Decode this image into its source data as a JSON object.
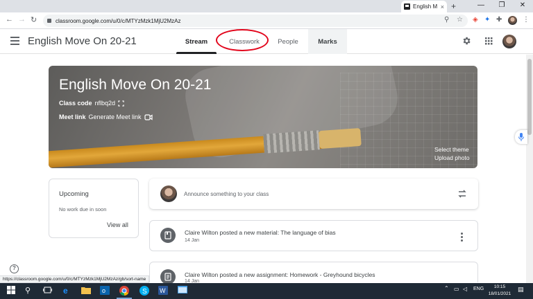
{
  "browser": {
    "tab_title": "English M",
    "tab_close": "×",
    "new_tab": "+",
    "url": "classroom.google.com/u/0/c/MTYzMzk1MjU2MzAz",
    "status_url": "https://classroom.google.com/u/0/c/MTYzMzk1MjU2MzAz/gb/sort-name"
  },
  "header": {
    "class_name": "English Move On 20-21",
    "tabs": [
      {
        "label": "Stream",
        "active": true
      },
      {
        "label": "Classwork"
      },
      {
        "label": "People"
      },
      {
        "label": "Marks"
      }
    ]
  },
  "banner": {
    "title": "English Move On 20-21",
    "class_code_label": "Class code",
    "class_code": "nflbq2d",
    "meet_label": "Meet link",
    "meet_action": "Generate Meet link",
    "select_theme": "Select theme",
    "upload_photo": "Upload photo"
  },
  "upcoming": {
    "title": "Upcoming",
    "empty": "No work due in soon",
    "view_all": "View all"
  },
  "stream": {
    "placeholder": "Announce something to your class",
    "posts": [
      {
        "title": "Claire Wilton posted a new material: The language of bias",
        "date": "14 Jan",
        "icon": "material-icon"
      },
      {
        "title": "Claire Wilton posted a new assignment: Homework - Greyhound bicycles",
        "date": "14 Jan",
        "icon": "assignment-icon"
      }
    ]
  },
  "taskbar": {
    "lang": "ENG",
    "time": "10:15",
    "date": "18/01/2021"
  },
  "colors": {
    "annotation_circle": "#e2061c",
    "active_tab": "#202124"
  }
}
